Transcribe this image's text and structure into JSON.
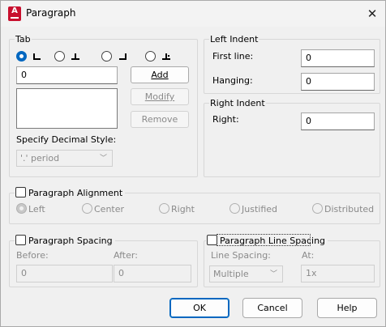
{
  "window": {
    "title": "Paragraph",
    "icon": "autocad-app-icon",
    "close_glyph": "✕"
  },
  "tab": {
    "group_label": "Tab",
    "radios": [
      {
        "name": "left-tab",
        "selected": true
      },
      {
        "name": "center-tab",
        "selected": false
      },
      {
        "name": "right-tab",
        "selected": false
      },
      {
        "name": "decimal-tab",
        "selected": false
      }
    ],
    "position_value": "0",
    "add": "Add",
    "modify": "Modify",
    "remove": "Remove",
    "decimal_style_label": "Specify Decimal Style:",
    "decimal_style_value": "'.' period"
  },
  "left_indent": {
    "group_label": "Left Indent",
    "first_line_label": "First line:",
    "first_line_value": "0",
    "hanging_label": "Hanging:",
    "hanging_value": "0"
  },
  "right_indent": {
    "group_label": "Right Indent",
    "right_label": "Right:",
    "right_value": "0"
  },
  "alignment": {
    "label": "Paragraph Alignment",
    "checked": false,
    "options": [
      "Left",
      "Center",
      "Right",
      "Justified",
      "Distributed"
    ],
    "selected": "Left"
  },
  "spacing": {
    "label": "Paragraph Spacing",
    "checked": false,
    "before_label": "Before:",
    "before_value": "0",
    "after_label": "After:",
    "after_value": "0"
  },
  "line_spacing": {
    "label": "Paragraph Line Spacing",
    "checked": false,
    "mode_label": "Line Spacing:",
    "mode_value": "Multiple",
    "at_label": "At:",
    "at_value": "1x"
  },
  "buttons": {
    "ok": "OK",
    "cancel": "Cancel",
    "help": "Help"
  }
}
